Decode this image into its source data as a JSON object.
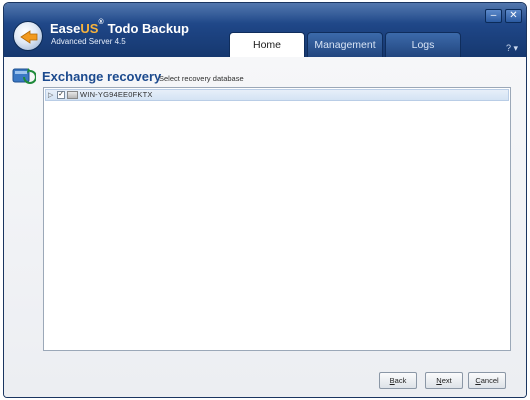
{
  "app": {
    "brand_part1": "Ease",
    "brand_part2": "US",
    "brand_part3": "Todo Backup",
    "version": "Advanced Server 4.5"
  },
  "window_controls": {
    "minimize": "–",
    "close": "✕"
  },
  "tabs": [
    {
      "label": "Home",
      "active": true
    },
    {
      "label": "Management",
      "active": false
    },
    {
      "label": "Logs",
      "active": false
    }
  ],
  "help_icon": "? ▾",
  "page": {
    "title": "Exchange recovery",
    "subtitle": "Select recovery database"
  },
  "tree": {
    "items": [
      {
        "label": "WIN-YG94EE0FKTX",
        "checked": true,
        "expanded": false
      }
    ]
  },
  "buttons": {
    "back_first": "B",
    "back_rest": "ack",
    "next_first": "N",
    "next_rest": "ext",
    "cancel_first": "C",
    "cancel_rest": "ancel"
  },
  "colors": {
    "titlebar": "#1e4585",
    "title_text": "#1c4a8e",
    "accent_orange": "#f6b23d"
  }
}
